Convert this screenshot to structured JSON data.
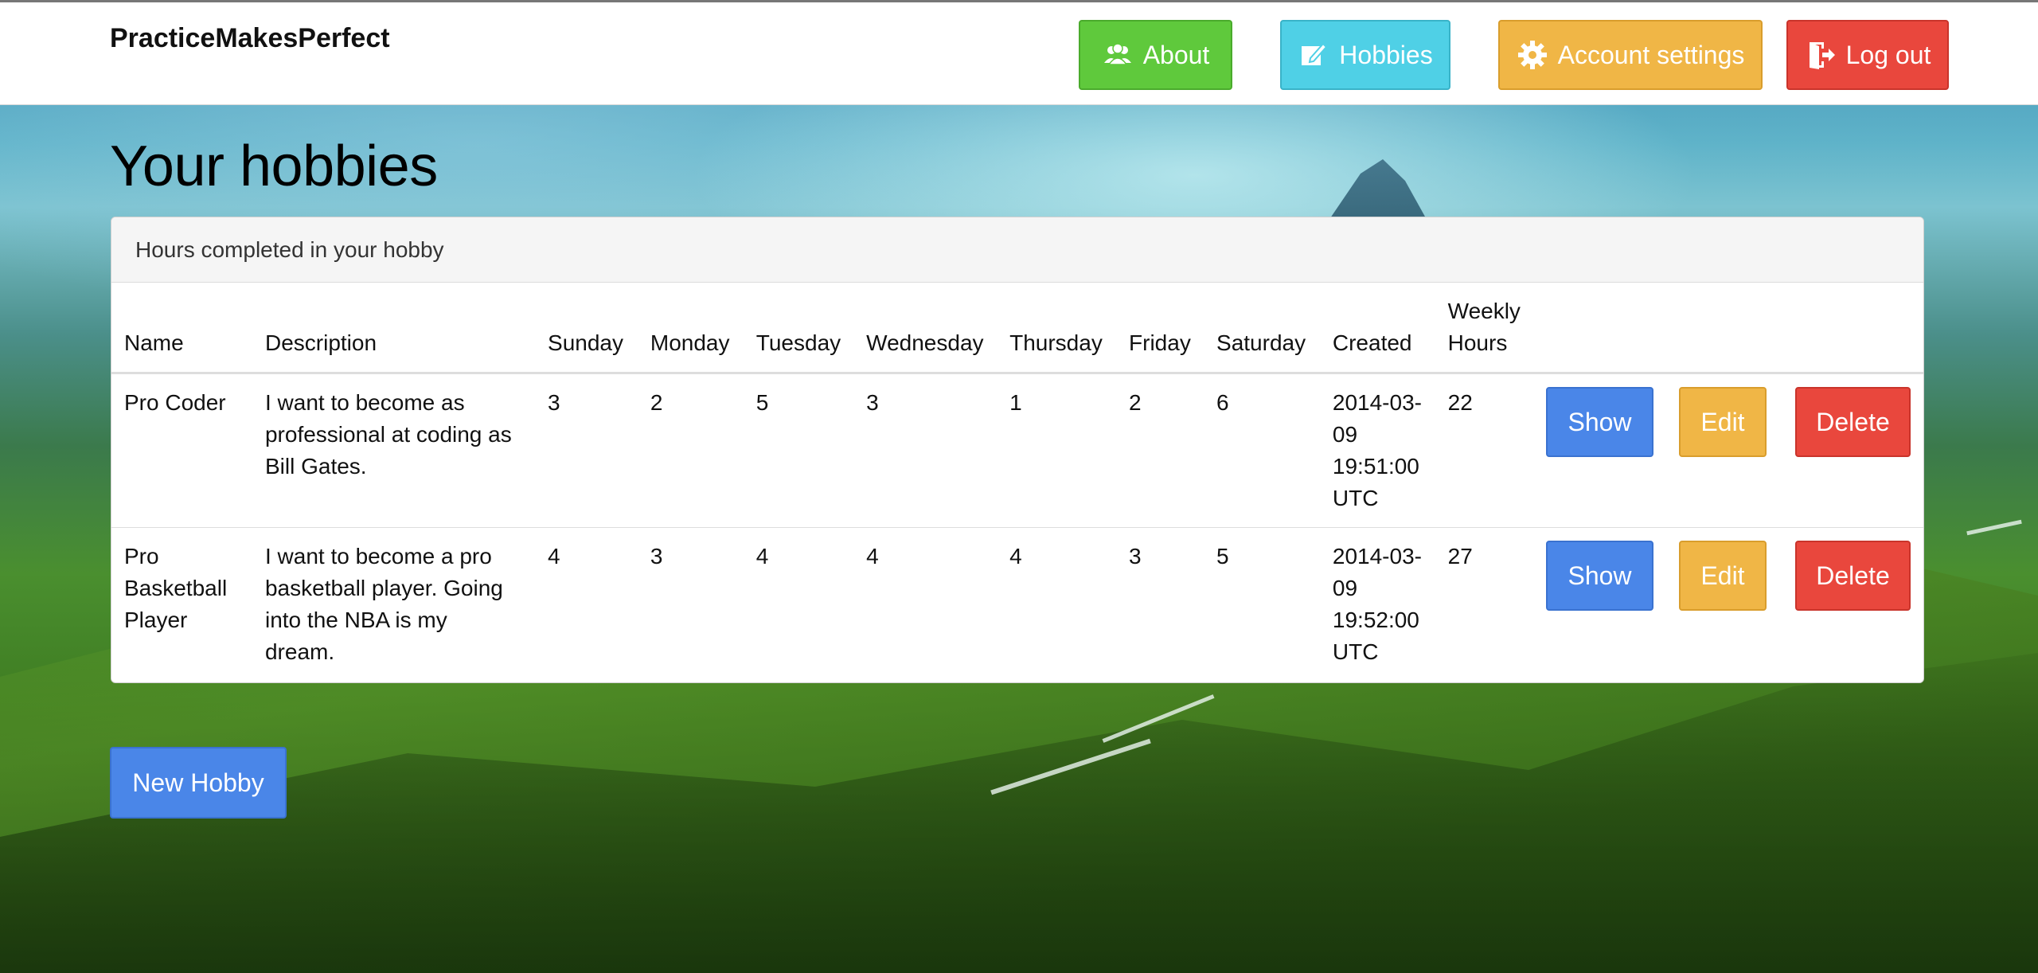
{
  "navbar": {
    "brand": "PracticeMakesPerfect",
    "buttons": {
      "about": {
        "label": "About",
        "icon": "users-icon",
        "color": "#5fc93c"
      },
      "hobbies": {
        "label": "Hobbies",
        "icon": "edit-icon",
        "color": "#4fd0e6"
      },
      "account": {
        "label": "Account settings",
        "icon": "gear-icon",
        "color": "#f0b646"
      },
      "logout": {
        "label": "Log out",
        "icon": "logout-icon",
        "color": "#e9473d"
      }
    }
  },
  "page": {
    "title": "Your hobbies"
  },
  "panel": {
    "heading": "Hours completed in your hobby",
    "columns": [
      "Name",
      "Description",
      "Sunday",
      "Monday",
      "Tuesday",
      "Wednesday",
      "Thursday",
      "Friday",
      "Saturday",
      "Created",
      "Weekly Hours"
    ],
    "rows": [
      {
        "name": "Pro Coder",
        "description": "I want to become as professional at coding as Bill Gates.",
        "sunday": "3",
        "monday": "2",
        "tuesday": "5",
        "wednesday": "3",
        "thursday": "1",
        "friday": "2",
        "saturday": "6",
        "created": "2014-03-09 19:51:00 UTC",
        "weekly_hours": "22",
        "actions": {
          "show": "Show",
          "edit": "Edit",
          "delete": "Delete"
        }
      },
      {
        "name": "Pro Basketball Player",
        "description": "I want to become a pro basketball player. Going into the NBA is my dream.",
        "sunday": "4",
        "monday": "3",
        "tuesday": "4",
        "wednesday": "4",
        "thursday": "4",
        "friday": "3",
        "saturday": "5",
        "created": "2014-03-09 19:52:00 UTC",
        "weekly_hours": "27",
        "actions": {
          "show": "Show",
          "edit": "Edit",
          "delete": "Delete"
        }
      }
    ]
  },
  "new_hobby_button": {
    "label": "New Hobby",
    "color": "#4a86e8"
  }
}
